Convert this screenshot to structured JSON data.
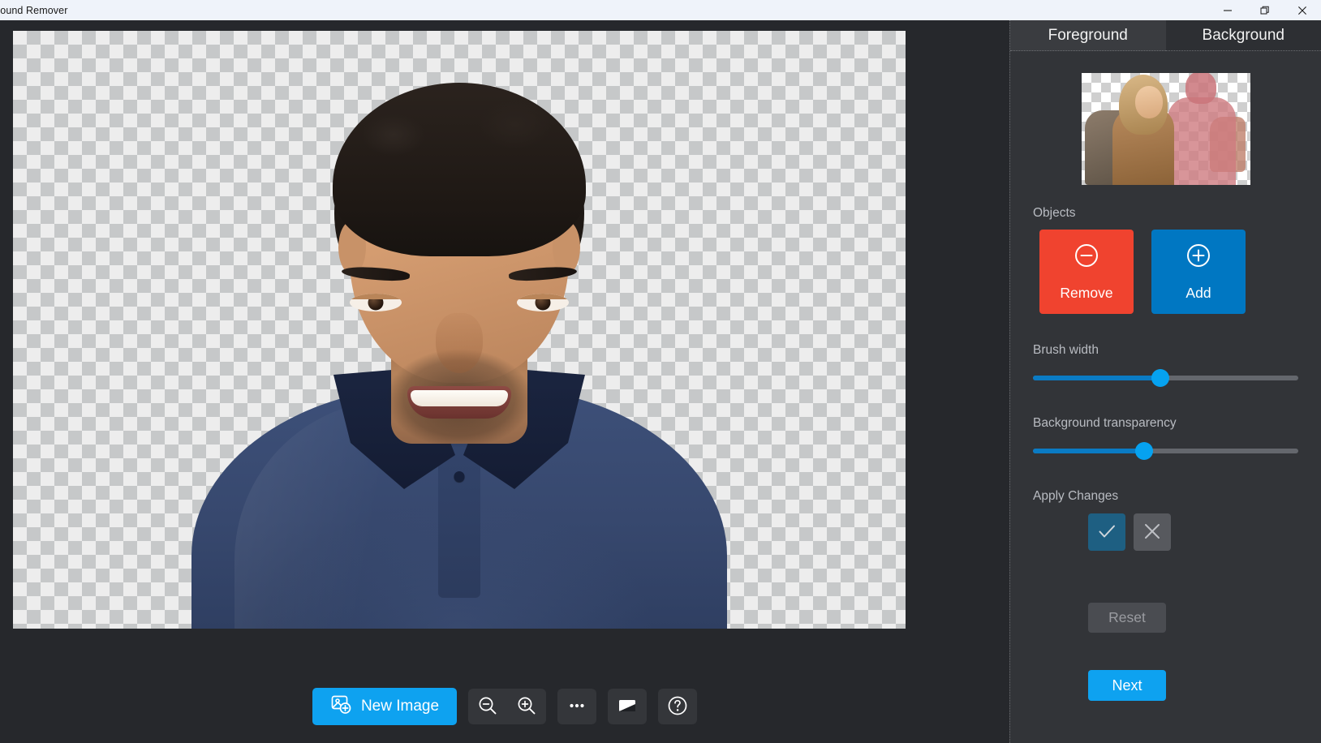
{
  "window": {
    "title": "round Remover",
    "controls": {
      "minimize": "minimize-icon",
      "restore": "restore-icon",
      "close": "close-icon"
    }
  },
  "canvas": {
    "checkerboard": true,
    "subject": "man-portrait-navy-polo",
    "background_removed": true
  },
  "toolbar": {
    "new_image_label": "New Image",
    "buttons": [
      {
        "name": "zoom-out",
        "icon": "zoom-out-icon"
      },
      {
        "name": "zoom-in",
        "icon": "zoom-in-icon"
      },
      {
        "name": "more-options",
        "icon": "ellipsis-icon"
      },
      {
        "name": "contrast-toggle",
        "icon": "contrast-icon"
      },
      {
        "name": "help",
        "icon": "question-mark-icon"
      }
    ]
  },
  "panel": {
    "tabs": [
      {
        "label": "Foreground",
        "active": true
      },
      {
        "label": "Background",
        "active": false
      }
    ],
    "preview": {
      "description": "woman-kept-man-marked-for-removal"
    },
    "objects": {
      "label": "Objects",
      "remove_label": "Remove",
      "add_label": "Add",
      "remove_color": "#F0432F",
      "add_color": "#0077C2"
    },
    "brush_width": {
      "label": "Brush width",
      "value": 48,
      "min": 0,
      "max": 100
    },
    "background_transparency": {
      "label": "Background transparency",
      "value": 42,
      "min": 0,
      "max": 100
    },
    "apply_changes": {
      "label": "Apply Changes",
      "confirm_icon": "checkmark-icon",
      "cancel_icon": "close-x-icon"
    },
    "reset_label": "Reset",
    "next_label": "Next"
  },
  "colors": {
    "accent_blue": "#0EA2F0",
    "panel_bg": "#323438",
    "workspace_bg": "#26282C",
    "titlebar_bg": "#EFF3FA"
  }
}
